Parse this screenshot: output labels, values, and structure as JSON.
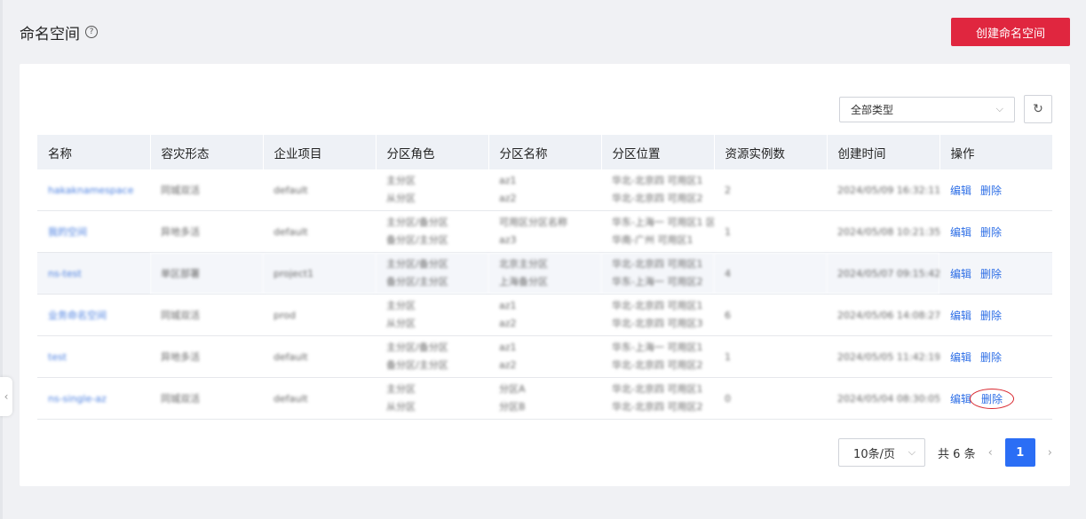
{
  "header": {
    "title": "命名空间",
    "help_icon": "?",
    "create_label": "创建命名空间"
  },
  "toolbar": {
    "type_filter": "全部类型",
    "chevron": "⌵",
    "refresh_icon": "↻"
  },
  "table": {
    "columns": [
      "名称",
      "容灾形态",
      "企业项目",
      "分区角色",
      "分区名称",
      "分区位置",
      "资源实例数",
      "创建时间",
      "操作"
    ],
    "rows": [
      {
        "name": "hakaknamespace",
        "dr": "同城双活",
        "project": "default",
        "role1": "主分区",
        "role2": "从分区",
        "pname1": "az1",
        "pname2": "az2",
        "loc1": "华北-北京四 可用区1",
        "loc2": "华北-北京四 可用区2",
        "count": "2",
        "time": "2024/05/09 16:32:11 GMT"
      },
      {
        "name": "我的空间",
        "dr": "异地多活",
        "project": "default",
        "role1": "主分区/备分区",
        "role2": "备分区/主分区",
        "pname1": "可用区分区名称",
        "pname2": "az3",
        "loc1": "华东-上海一 可用区1 区域2",
        "loc2": "华南-广州 可用区1",
        "count": "1",
        "time": "2024/05/08 10:21:35 GMT"
      },
      {
        "name": "ns-test",
        "dr": "单区部署",
        "project": "project1",
        "role1": "主分区/备分区",
        "role2": "备分区/主分区",
        "pname1": "北京主分区",
        "pname2": "上海备分区",
        "loc1": "华北-北京四 可用区1",
        "loc2": "华东-上海一 可用区2",
        "count": "4",
        "time": "2024/05/07 09:15:42 GMT"
      },
      {
        "name": "业务命名空间",
        "dr": "同城双活",
        "project": "prod",
        "role1": "主分区",
        "role2": "从分区",
        "pname1": "az1",
        "pname2": "az2",
        "loc1": "华北-北京四 可用区1",
        "loc2": "华北-北京四 可用区3",
        "count": "6",
        "time": "2024/05/06 14:08:27 GMT"
      },
      {
        "name": "test",
        "dr": "异地多活",
        "project": "default",
        "role1": "主分区/备分区",
        "role2": "备分区/主分区",
        "pname1": "az1",
        "pname2": "az2",
        "loc1": "华东-上海一 可用区1",
        "loc2": "华北-北京四 可用区2",
        "count": "1",
        "time": "2024/05/05 11:42:19 GMT"
      },
      {
        "name": "ns-single-az",
        "dr": "同城双活",
        "project": "default",
        "role1": "主分区",
        "role2": "从分区",
        "pname1": "分区A",
        "pname2": "分区B",
        "loc1": "华北-北京四 可用区1",
        "loc2": "华北-北京四 可用区2",
        "count": "0",
        "time": "2024/05/04 08:30:05 GMT"
      }
    ],
    "edit_label": "编辑",
    "delete_label": "删除"
  },
  "pagination": {
    "page_size": "10条/页",
    "total": "共 6 条",
    "current_page": "1",
    "prev": "‹",
    "next": "›"
  },
  "colors": {
    "primary_red": "#e0263f",
    "link_blue": "#2d6ee6",
    "page_blue": "#2b6ef5"
  }
}
